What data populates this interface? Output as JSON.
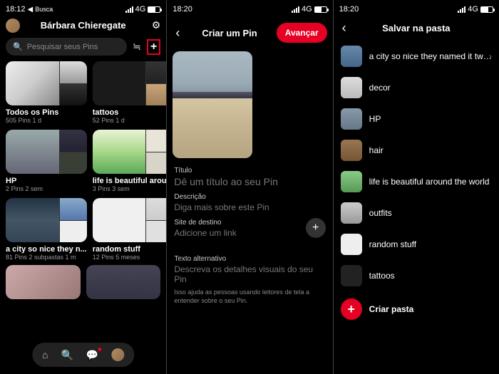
{
  "status": {
    "time1": "18:12",
    "time2": "18:20",
    "time3": "18:20",
    "back_label": "Busca",
    "network": "4G"
  },
  "screen1": {
    "title": "Bárbara Chieregate",
    "search_placeholder": "Pesquisar seus Pins",
    "boards": [
      {
        "name": "Todos os Pins",
        "meta": "505 Pins  1 d",
        "cls": "allpins"
      },
      {
        "name": "tattoos",
        "meta": "52 Pins  1 d",
        "cls": "tattoos"
      },
      {
        "name": "HP",
        "meta": "2 Pins  2 sem",
        "cls": "hp"
      },
      {
        "name": "life is beautiful arou...",
        "meta": "3 Pins  3 sem",
        "cls": "life"
      },
      {
        "name": "a city so nice they n...",
        "meta": "81 Pins  2 subpastas  1 m",
        "cls": "city"
      },
      {
        "name": "random stuff",
        "meta": "12 Pins  5 meses",
        "cls": "random"
      }
    ]
  },
  "screen2": {
    "header": "Criar um Pin",
    "advance": "Avançar",
    "title_label": "Título",
    "title_placeholder": "Dê um título ao seu Pin",
    "desc_label": "Descrição",
    "desc_placeholder": "Diga mais sobre este Pin",
    "link_label": "Site de destino",
    "link_placeholder": "Adicione um link",
    "alt_label": "Texto alternativo",
    "alt_placeholder": "Descreva os detalhes visuais do seu Pin",
    "alt_help": "Isso ajuda as pessoas usando leitores de tela a entender sobre o seu Pin."
  },
  "screen3": {
    "header": "Salvar na pasta",
    "folders": [
      {
        "name": "a city so nice they named it twice",
        "cls": "ft-city",
        "chevron": true
      },
      {
        "name": "decor",
        "cls": "ft-decor"
      },
      {
        "name": "HP",
        "cls": "ft-hp"
      },
      {
        "name": "hair",
        "cls": "ft-hair"
      },
      {
        "name": "life is beautiful around the world",
        "cls": "ft-life"
      },
      {
        "name": "outfits",
        "cls": "ft-outfits"
      },
      {
        "name": "random stuff",
        "cls": "ft-random"
      },
      {
        "name": "tattoos",
        "cls": "ft-tattoos"
      }
    ],
    "create": "Criar pasta"
  }
}
